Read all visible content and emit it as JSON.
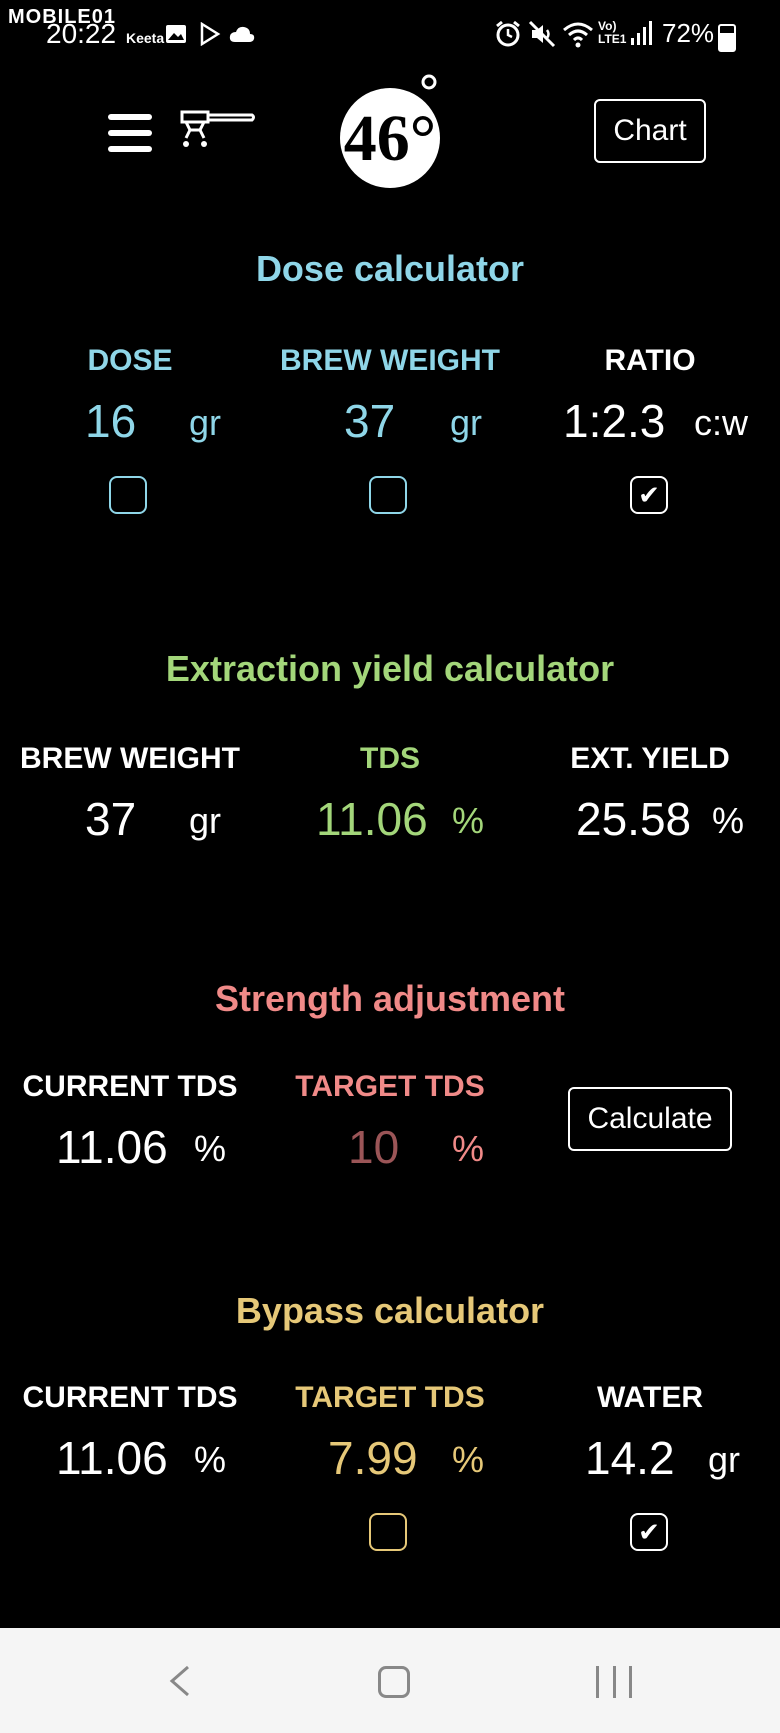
{
  "status_bar": {
    "watermark": "MOBILE01",
    "time": "20:22",
    "app_badge": "Keeta",
    "battery": "72%"
  },
  "header": {
    "logo_text": "46°",
    "chart_button": "Chart"
  },
  "colors": {
    "dose": "#8fd6e8",
    "extraction": "#a3d67a",
    "strength": "#f08a88",
    "strength_value": "#9b5557",
    "bypass": "#e6c878"
  },
  "dose_calculator": {
    "title": "Dose calculator",
    "dose": {
      "label": "DOSE",
      "value": "16",
      "unit": "gr",
      "checked": false
    },
    "brew_weight": {
      "label": "BREW WEIGHT",
      "value": "37",
      "unit": "gr",
      "checked": false
    },
    "ratio": {
      "label": "RATIO",
      "value": "1:2.3",
      "unit": "c:w",
      "checked": true
    }
  },
  "extraction_calculator": {
    "title": "Extraction yield calculator",
    "brew_weight": {
      "label": "BREW WEIGHT",
      "value": "37",
      "unit": "gr"
    },
    "tds": {
      "label": "TDS",
      "value": "11.06",
      "unit": "%"
    },
    "ext_yield": {
      "label": "EXT. YIELD",
      "value": "25.58",
      "unit": "%"
    }
  },
  "strength_adjustment": {
    "title": "Strength adjustment",
    "current_tds": {
      "label": "CURRENT TDS",
      "value": "11.06",
      "unit": "%"
    },
    "target_tds": {
      "label": "TARGET TDS",
      "value": "10",
      "unit": "%"
    },
    "calculate_button": "Calculate"
  },
  "bypass_calculator": {
    "title": "Bypass calculator",
    "current_tds": {
      "label": "CURRENT TDS",
      "value": "11.06",
      "unit": "%"
    },
    "target_tds": {
      "label": "TARGET TDS",
      "value": "7.99",
      "unit": "%",
      "checked": false
    },
    "water": {
      "label": "WATER",
      "value": "14.2",
      "unit": "gr",
      "checked": true
    }
  }
}
